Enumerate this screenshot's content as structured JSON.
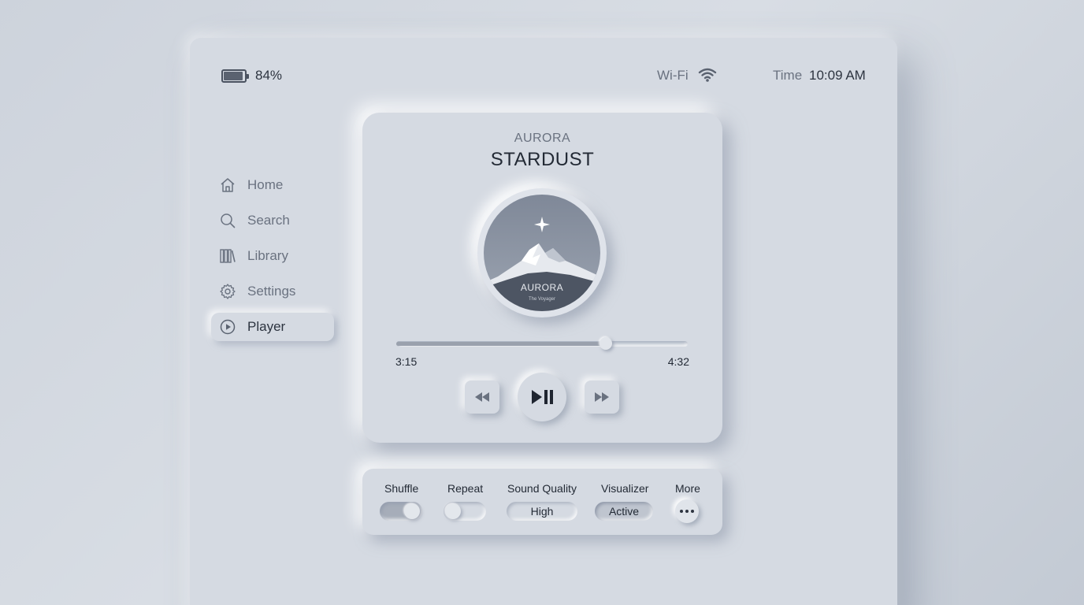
{
  "status_bar": {
    "battery": "84%",
    "wifi_label": "Wi-Fi",
    "time_label": "Time",
    "time_value": "10:09 AM"
  },
  "sidebar": {
    "items": [
      {
        "label": "Home",
        "icon": "home-icon",
        "active": false
      },
      {
        "label": "Search",
        "icon": "search-icon",
        "active": false
      },
      {
        "label": "Library",
        "icon": "library-icon",
        "active": false
      },
      {
        "label": "Settings",
        "icon": "gear-icon",
        "active": false
      },
      {
        "label": "Player",
        "icon": "play-circle-icon",
        "active": true
      }
    ]
  },
  "player": {
    "artist": "AURORA",
    "track": "STARDUST",
    "album_art": {
      "title": "AURORA",
      "subtitle": "The Voyager"
    },
    "elapsed": "3:15",
    "duration": "4:32",
    "progress": 0.72
  },
  "settings": {
    "shuffle": {
      "label": "Shuffle",
      "on": true
    },
    "repeat": {
      "label": "Repeat",
      "on": false
    },
    "sound_quality": {
      "label": "Sound Quality",
      "value": "High"
    },
    "visualizer": {
      "label": "Visualizer",
      "value": "Active"
    },
    "more": {
      "label": "More"
    }
  },
  "colors": {
    "background": "#d5dae2",
    "text_dark": "#232a35",
    "text_muted": "#6a7280"
  }
}
